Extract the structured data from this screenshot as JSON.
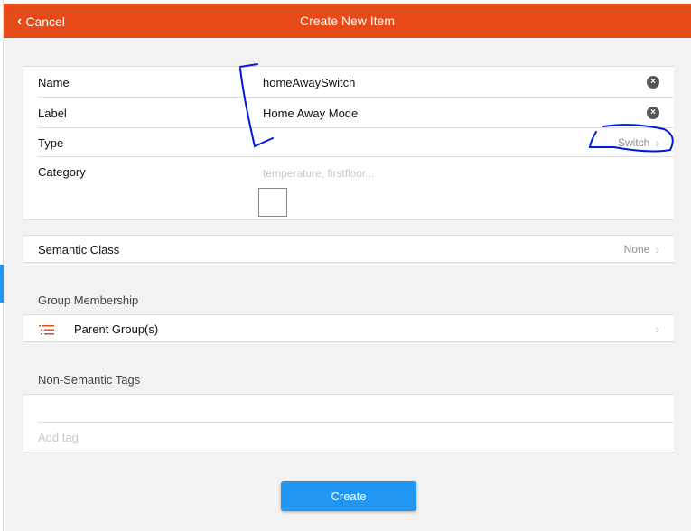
{
  "header": {
    "cancel_label": "Cancel",
    "title": "Create New Item"
  },
  "form": {
    "name": {
      "label": "Name",
      "value": "homeAwaySwitch"
    },
    "label": {
      "label": "Label",
      "value": "Home Away Mode"
    },
    "type": {
      "label": "Type",
      "value": "Switch"
    },
    "category": {
      "label": "Category",
      "placeholder": "temperature, firstfloor..."
    }
  },
  "semantic": {
    "label": "Semantic Class",
    "value": "None"
  },
  "group": {
    "section_title": "Group Membership",
    "parent_label": "Parent Group(s)"
  },
  "tags": {
    "section_title": "Non-Semantic Tags",
    "placeholder": "Add tag"
  },
  "actions": {
    "create_label": "Create"
  },
  "colors": {
    "header": "#e64a19",
    "button": "#2196f3",
    "annotation": "#0018e0"
  }
}
